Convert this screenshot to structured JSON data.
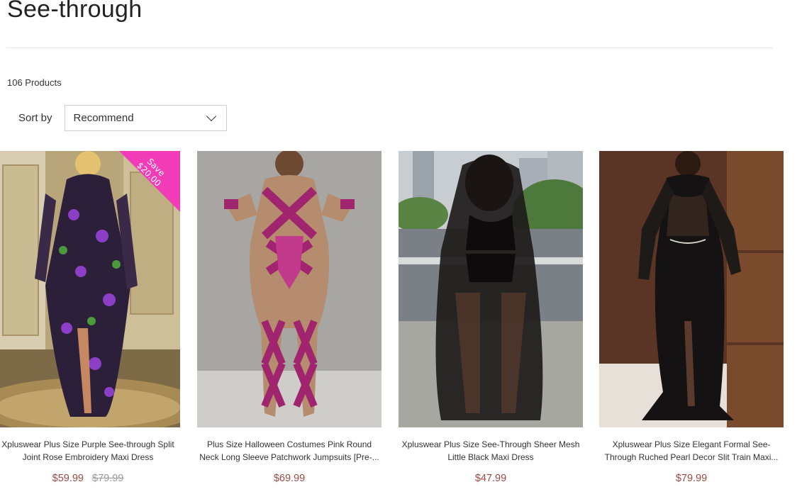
{
  "page": {
    "title": "See-through",
    "product_count": "106 Products"
  },
  "sort": {
    "label": "Sort by",
    "selected": "Recommend",
    "icon": "chevron-down-icon"
  },
  "products": [
    {
      "name": "Xpluswear Plus Size Purple See-through Split Joint Rose Embroidery Maxi Dress",
      "price": "$59.99",
      "old_price": "$79.99",
      "badge": {
        "line1": "Save",
        "line2": "$20.00",
        "color": "#f23bb6"
      }
    },
    {
      "name": "Plus Size Halloween Costumes Pink Round Neck Long Sleeve Patchwork Jumpsuits [Pre-...",
      "price": "$69.99",
      "old_price": ""
    },
    {
      "name": "Xpluswear Plus Size See-Through Sheer Mesh Little Black Maxi Dress",
      "price": "$47.99",
      "old_price": ""
    },
    {
      "name": "Xpluswear Plus Size Elegant Formal See-Through Ruched Pearl Decor Slit Train Maxi...",
      "price": "$79.99",
      "old_price": ""
    }
  ],
  "colors": {
    "price": "#9a4a43",
    "badge": "#f23bb6"
  }
}
